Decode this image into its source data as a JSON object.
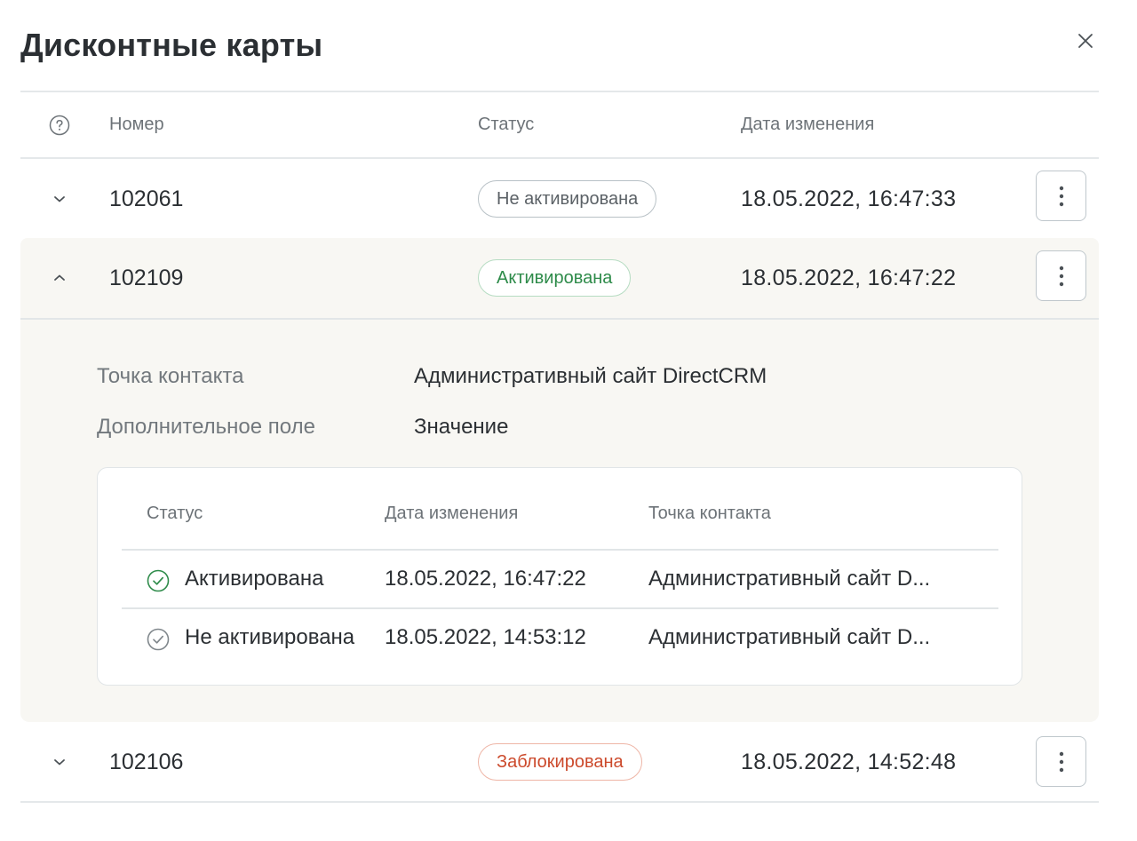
{
  "dialog": {
    "title": "Дисконтные карты"
  },
  "table": {
    "headers": {
      "number": "Номер",
      "status": "Статус",
      "date": "Дата изменения"
    },
    "rows": [
      {
        "number": "102061",
        "status": "Не активирована",
        "status_tone": "grey",
        "date": "18.05.2022, 16:47:33",
        "expanded": false
      },
      {
        "number": "102109",
        "status": "Активирована",
        "status_tone": "green",
        "date": "18.05.2022, 16:47:22",
        "expanded": true
      },
      {
        "number": "102106",
        "status": "Заблокирована",
        "status_tone": "red",
        "date": "18.05.2022, 14:52:48",
        "expanded": false
      }
    ]
  },
  "detail": {
    "fields": [
      {
        "label": "Точка контакта",
        "value": "Административный сайт DirectCRM"
      },
      {
        "label": "Дополнительное поле",
        "value": "Значение"
      }
    ],
    "history": {
      "headers": {
        "status": "Статус",
        "date": "Дата изменения",
        "point": "Точка контакта"
      },
      "rows": [
        {
          "status": "Активирована",
          "date": "18.05.2022, 16:47:22",
          "point": "Административный сайт D...",
          "icon": "check-circle-icon",
          "active": true
        },
        {
          "status": "Не активирована",
          "date": "18.05.2022, 14:53:12",
          "point": "Административный сайт D...",
          "icon": "check-circle-icon",
          "active": false
        }
      ]
    }
  },
  "colors": {
    "green": "#2e8b4a",
    "red": "#cc4a2c",
    "grey": "#5b6166",
    "expanded_bg": "#f8f7f3"
  },
  "icons": {
    "help": "question-circle-icon",
    "close": "close-icon",
    "collapsed": "chevron-down-icon",
    "expanded": "chevron-up-icon",
    "menu": "more-vertical-icon"
  }
}
